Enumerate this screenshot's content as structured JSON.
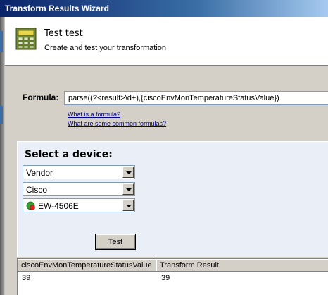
{
  "window": {
    "title": "Transform Results Wizard"
  },
  "header": {
    "icon": "calculator-icon",
    "title": "Test test",
    "subtitle": "Create and test your transformation"
  },
  "formula": {
    "label": "Formula:",
    "value": "parse((?<result>\\d+),{ciscoEnvMonTemperatureStatusValue})",
    "links": [
      "What is a formula?",
      "What are some common formulas?"
    ]
  },
  "device": {
    "heading": "Select a device:",
    "combos": [
      "Vendor",
      "Cisco",
      "EW-4506E"
    ],
    "node_icon": "node-status-icon",
    "node_colors": {
      "ok": "#2ea02e",
      "alert": "#e02020"
    }
  },
  "test_button": {
    "label": "Test"
  },
  "results": {
    "columns": [
      "ciscoEnvMonTemperatureStatusValue",
      "Transform Result"
    ],
    "rows": [
      [
        "39",
        "39"
      ]
    ]
  }
}
